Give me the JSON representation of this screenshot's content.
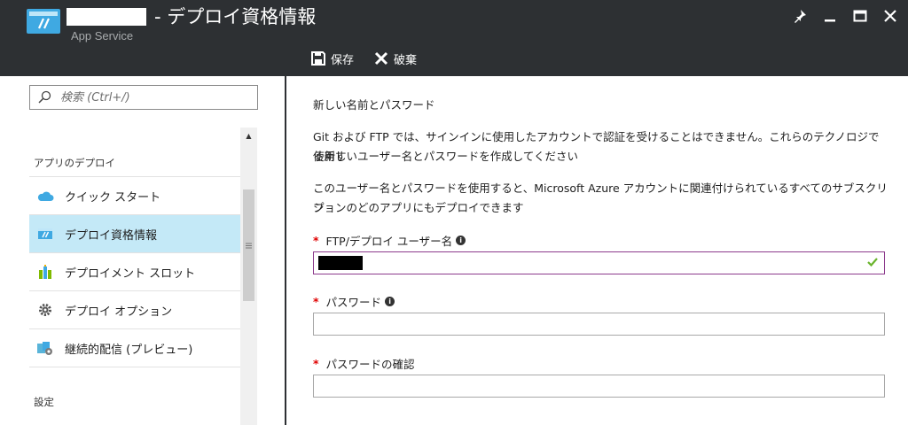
{
  "header": {
    "title": "- デプロイ資格情報",
    "subtitle": "App Service"
  },
  "toolbar": {
    "save_label": "保存",
    "discard_label": "破棄"
  },
  "sidebar": {
    "search_placeholder": "検索 (Ctrl+/)",
    "section_deploy": "アプリのデプロイ",
    "section_settings": "設定",
    "items": [
      {
        "label": "クイック スタート",
        "icon": "cloud-icon"
      },
      {
        "label": "デプロイ資格情報",
        "icon": "app-service-icon",
        "active": true
      },
      {
        "label": "デプロイメント スロット",
        "icon": "slots-icon"
      },
      {
        "label": "デプロイ オプション",
        "icon": "gear-icon"
      },
      {
        "label": "継続的配信 (プレビュー)",
        "icon": "continuous-delivery-icon"
      }
    ]
  },
  "main": {
    "heading": "新しい名前とパスワード",
    "para1_line1": "Git および FTP では、サインインに使用したアカウントで認証を受けることはできません。これらのテクノロジで使用す",
    "para1_line2": "る新しいユーザー名とパスワードを作成してください",
    "para2_line1": "このユーザー名とパスワードを使用すると、Microsoft Azure アカウントに関連付けられているすべてのサブスクリプ",
    "para2_line2": "ションのどのアプリにもデプロイできます",
    "username_label": "FTP/デプロイ ユーザー名",
    "password_label": "パスワード",
    "confirm_label": "パスワードの確認",
    "required_mark": "*"
  },
  "colors": {
    "header_bg": "#2d3033",
    "active_nav": "#c4e9f7",
    "required": "#e00000",
    "valid_check": "#6ab42d",
    "valid_border": "#8c3a8c"
  }
}
